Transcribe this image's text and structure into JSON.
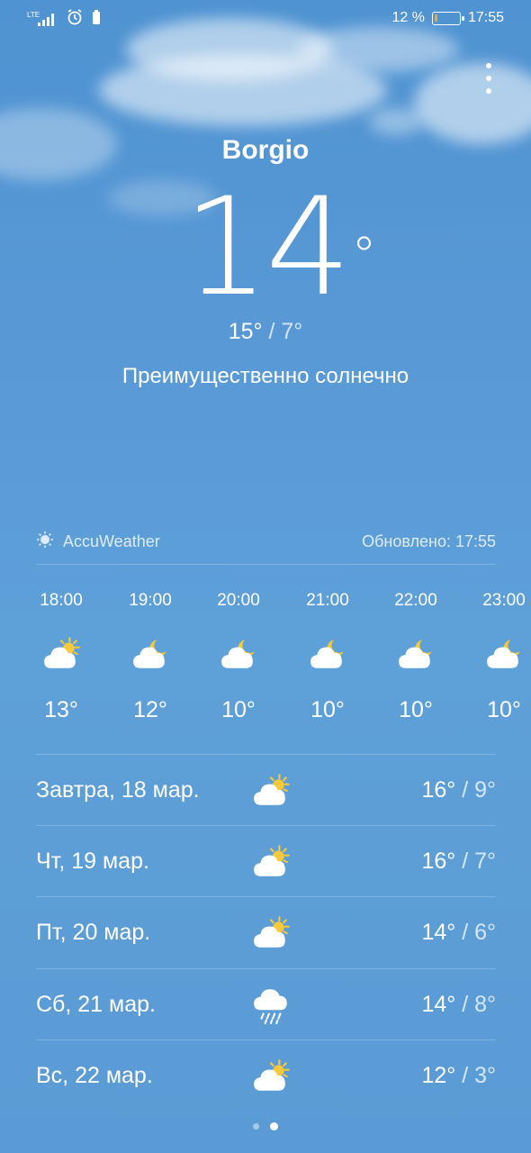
{
  "status": {
    "network": "LTE",
    "battery_percent": "12 %",
    "battery_level": 0.12,
    "time": "17:55"
  },
  "location": {
    "city": "Borgio"
  },
  "current": {
    "temp": "14",
    "deg": "°",
    "high": "15°",
    "separator": " / ",
    "low": "7°",
    "condition": "Преимущественно солнечно"
  },
  "source": {
    "provider": "AccuWeather",
    "updated": "Обновлено: 17:55"
  },
  "hourly": [
    {
      "time": "18:00",
      "temp": "13°",
      "icon": "partly-sunny-icon"
    },
    {
      "time": "19:00",
      "temp": "12°",
      "icon": "partly-cloudy-night-icon"
    },
    {
      "time": "20:00",
      "temp": "10°",
      "icon": "partly-cloudy-night-icon"
    },
    {
      "time": "21:00",
      "temp": "10°",
      "icon": "partly-cloudy-night-icon"
    },
    {
      "time": "22:00",
      "temp": "10°",
      "icon": "partly-cloudy-night-icon"
    },
    {
      "time": "23:00",
      "temp": "10°",
      "icon": "partly-cloudy-night-icon"
    }
  ],
  "daily": [
    {
      "date": "Завтра, 18 мар.",
      "high": "16°",
      "low": "9°",
      "icon": "partly-sunny-icon"
    },
    {
      "date": "Чт, 19 мар.",
      "high": "16°",
      "low": "7°",
      "icon": "partly-sunny-icon"
    },
    {
      "date": "Пт, 20 мар.",
      "high": "14°",
      "low": "6°",
      "icon": "partly-sunny-icon"
    },
    {
      "date": "Сб, 21 мар.",
      "high": "14°",
      "low": "8°",
      "icon": "rain-icon"
    },
    {
      "date": "Вс, 22 мар.",
      "high": "12°",
      "low": "3°",
      "icon": "partly-sunny-icon"
    }
  ],
  "colors": {
    "sun": "#f8c93a",
    "battery_fill": "#f5a623",
    "background": "#5b9bd5"
  },
  "pager": {
    "pages": 2,
    "active": 1
  }
}
